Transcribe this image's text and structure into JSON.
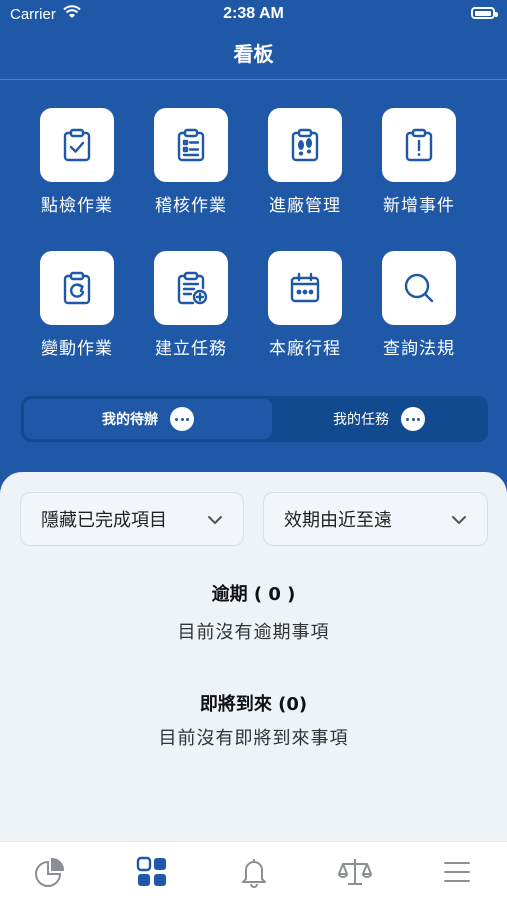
{
  "status": {
    "carrier": "Carrier",
    "time": "2:38 AM"
  },
  "header": {
    "title": "看板"
  },
  "tiles": [
    {
      "label": "點檢作業",
      "icon": "clipboard-check-icon"
    },
    {
      "label": "稽核作業",
      "icon": "clipboard-list-icon"
    },
    {
      "label": "進廠管理",
      "icon": "footprints-icon"
    },
    {
      "label": "新增事件",
      "icon": "clipboard-alert-icon"
    },
    {
      "label": "變動作業",
      "icon": "clipboard-refresh-icon"
    },
    {
      "label": "建立任務",
      "icon": "clipboard-add-icon"
    },
    {
      "label": "本廠行程",
      "icon": "calendar-icon"
    },
    {
      "label": "查詢法規",
      "icon": "search-icon"
    }
  ],
  "segment": {
    "tab1": "我的待辦",
    "tab2": "我的任務",
    "active": "tab1"
  },
  "filters": {
    "completed": "隱藏已完成項目",
    "sort": "效期由近至遠"
  },
  "overdue": {
    "heading": "逾期 ( 0 )",
    "empty": "目前沒有逾期事項"
  },
  "upcoming": {
    "heading": "即將到來 (0)",
    "empty": "目前沒有即將到來事項"
  },
  "tabbar": {
    "items": [
      "pie-chart-icon",
      "dashboard-grid-icon",
      "bell-icon",
      "scale-icon",
      "menu-icon"
    ],
    "active": "dashboard-grid-icon"
  },
  "colors": {
    "primary": "#1f58a6",
    "segment_bg": "#114a8e",
    "sheet_bg": "#eef3f8"
  }
}
